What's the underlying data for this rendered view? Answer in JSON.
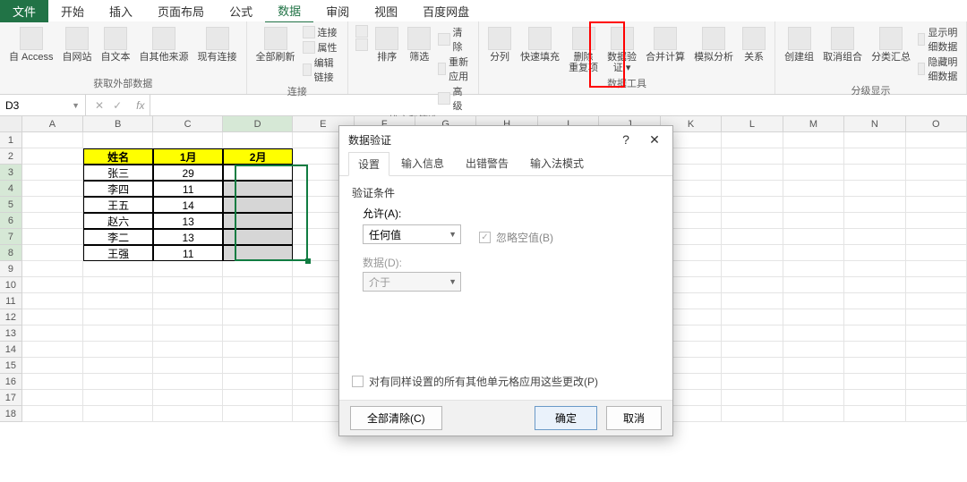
{
  "menu": {
    "file": "文件",
    "tabs": [
      "开始",
      "插入",
      "页面布局",
      "公式",
      "数据",
      "审阅",
      "视图",
      "百度网盘"
    ],
    "active": 4
  },
  "ribbon": {
    "ext": {
      "access": "自 Access",
      "web": "自网站",
      "text": "自文本",
      "other": "自其他来源",
      "conn": "现有连接",
      "label": "获取外部数据"
    },
    "conn": {
      "refresh": "全部刷新",
      "l1": "连接",
      "l2": "属性",
      "l3": "编辑链接",
      "label": "连接"
    },
    "sort": {
      "az": "A↓Z",
      "za": "Z↓A",
      "sort": "排序",
      "filter": "筛选",
      "clear": "清除",
      "reapply": "重新应用",
      "adv": "高级",
      "label": "排序和筛选"
    },
    "data": {
      "t2c": "分列",
      "flash": "快速填充",
      "dedup": "删除\n重复项",
      "dv": "数据验\n证 ▾",
      "consol": "合并计算",
      "whatif": "模拟分析",
      "rel": "关系",
      "label": "数据工具"
    },
    "outline": {
      "group": "创建组",
      "ungroup": "取消组合",
      "subtotal": "分类汇总",
      "showd": "显示明细数据",
      "hided": "隐藏明细数据",
      "label": "分级显示"
    }
  },
  "fbar": {
    "name": "D3",
    "fx": "fx"
  },
  "cols": [
    "A",
    "B",
    "C",
    "D",
    "E",
    "F",
    "G",
    "H",
    "I",
    "J",
    "K",
    "L",
    "M",
    "N",
    "O"
  ],
  "activeCol": 3,
  "activeRows": [
    3,
    4,
    5,
    6,
    7,
    8
  ],
  "table": {
    "header": [
      "姓名",
      "1月",
      "2月"
    ],
    "rows": [
      [
        "张三",
        "29",
        ""
      ],
      [
        "李四",
        "11",
        ""
      ],
      [
        "王五",
        "14",
        ""
      ],
      [
        "赵六",
        "13",
        ""
      ],
      [
        "李二",
        "13",
        ""
      ],
      [
        "王强",
        "11",
        ""
      ]
    ]
  },
  "dialog": {
    "title": "数据验证",
    "tabs": [
      "设置",
      "输入信息",
      "出错警告",
      "输入法模式"
    ],
    "activeTab": 0,
    "section": "验证条件",
    "allowLabel": "允许(A):",
    "allowValue": "任何值",
    "ignoreBlank": "忽略空值(B)",
    "dataLabel": "数据(D):",
    "dataValue": "介于",
    "applyAll": "对有同样设置的所有其他单元格应用这些更改(P)",
    "clear": "全部清除(C)",
    "ok": "确定",
    "cancel": "取消"
  }
}
